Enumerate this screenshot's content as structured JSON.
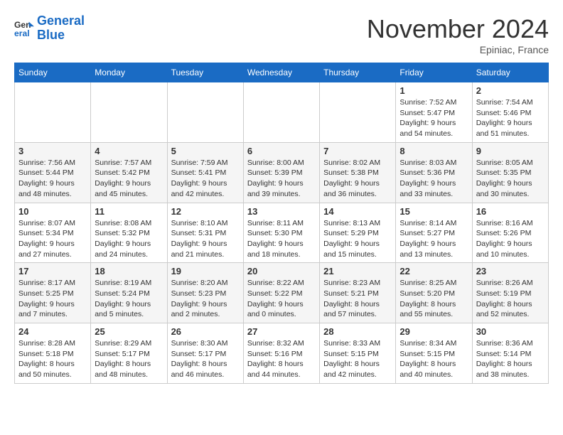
{
  "header": {
    "logo_line1": "General",
    "logo_line2": "Blue",
    "month": "November 2024",
    "location": "Epiniac, France"
  },
  "weekdays": [
    "Sunday",
    "Monday",
    "Tuesday",
    "Wednesday",
    "Thursday",
    "Friday",
    "Saturday"
  ],
  "weeks": [
    [
      {
        "day": "",
        "info": ""
      },
      {
        "day": "",
        "info": ""
      },
      {
        "day": "",
        "info": ""
      },
      {
        "day": "",
        "info": ""
      },
      {
        "day": "",
        "info": ""
      },
      {
        "day": "1",
        "info": "Sunrise: 7:52 AM\nSunset: 5:47 PM\nDaylight: 9 hours and 54 minutes."
      },
      {
        "day": "2",
        "info": "Sunrise: 7:54 AM\nSunset: 5:46 PM\nDaylight: 9 hours and 51 minutes."
      }
    ],
    [
      {
        "day": "3",
        "info": "Sunrise: 7:56 AM\nSunset: 5:44 PM\nDaylight: 9 hours and 48 minutes."
      },
      {
        "day": "4",
        "info": "Sunrise: 7:57 AM\nSunset: 5:42 PM\nDaylight: 9 hours and 45 minutes."
      },
      {
        "day": "5",
        "info": "Sunrise: 7:59 AM\nSunset: 5:41 PM\nDaylight: 9 hours and 42 minutes."
      },
      {
        "day": "6",
        "info": "Sunrise: 8:00 AM\nSunset: 5:39 PM\nDaylight: 9 hours and 39 minutes."
      },
      {
        "day": "7",
        "info": "Sunrise: 8:02 AM\nSunset: 5:38 PM\nDaylight: 9 hours and 36 minutes."
      },
      {
        "day": "8",
        "info": "Sunrise: 8:03 AM\nSunset: 5:36 PM\nDaylight: 9 hours and 33 minutes."
      },
      {
        "day": "9",
        "info": "Sunrise: 8:05 AM\nSunset: 5:35 PM\nDaylight: 9 hours and 30 minutes."
      }
    ],
    [
      {
        "day": "10",
        "info": "Sunrise: 8:07 AM\nSunset: 5:34 PM\nDaylight: 9 hours and 27 minutes."
      },
      {
        "day": "11",
        "info": "Sunrise: 8:08 AM\nSunset: 5:32 PM\nDaylight: 9 hours and 24 minutes."
      },
      {
        "day": "12",
        "info": "Sunrise: 8:10 AM\nSunset: 5:31 PM\nDaylight: 9 hours and 21 minutes."
      },
      {
        "day": "13",
        "info": "Sunrise: 8:11 AM\nSunset: 5:30 PM\nDaylight: 9 hours and 18 minutes."
      },
      {
        "day": "14",
        "info": "Sunrise: 8:13 AM\nSunset: 5:29 PM\nDaylight: 9 hours and 15 minutes."
      },
      {
        "day": "15",
        "info": "Sunrise: 8:14 AM\nSunset: 5:27 PM\nDaylight: 9 hours and 13 minutes."
      },
      {
        "day": "16",
        "info": "Sunrise: 8:16 AM\nSunset: 5:26 PM\nDaylight: 9 hours and 10 minutes."
      }
    ],
    [
      {
        "day": "17",
        "info": "Sunrise: 8:17 AM\nSunset: 5:25 PM\nDaylight: 9 hours and 7 minutes."
      },
      {
        "day": "18",
        "info": "Sunrise: 8:19 AM\nSunset: 5:24 PM\nDaylight: 9 hours and 5 minutes."
      },
      {
        "day": "19",
        "info": "Sunrise: 8:20 AM\nSunset: 5:23 PM\nDaylight: 9 hours and 2 minutes."
      },
      {
        "day": "20",
        "info": "Sunrise: 8:22 AM\nSunset: 5:22 PM\nDaylight: 9 hours and 0 minutes."
      },
      {
        "day": "21",
        "info": "Sunrise: 8:23 AM\nSunset: 5:21 PM\nDaylight: 8 hours and 57 minutes."
      },
      {
        "day": "22",
        "info": "Sunrise: 8:25 AM\nSunset: 5:20 PM\nDaylight: 8 hours and 55 minutes."
      },
      {
        "day": "23",
        "info": "Sunrise: 8:26 AM\nSunset: 5:19 PM\nDaylight: 8 hours and 52 minutes."
      }
    ],
    [
      {
        "day": "24",
        "info": "Sunrise: 8:28 AM\nSunset: 5:18 PM\nDaylight: 8 hours and 50 minutes."
      },
      {
        "day": "25",
        "info": "Sunrise: 8:29 AM\nSunset: 5:17 PM\nDaylight: 8 hours and 48 minutes."
      },
      {
        "day": "26",
        "info": "Sunrise: 8:30 AM\nSunset: 5:17 PM\nDaylight: 8 hours and 46 minutes."
      },
      {
        "day": "27",
        "info": "Sunrise: 8:32 AM\nSunset: 5:16 PM\nDaylight: 8 hours and 44 minutes."
      },
      {
        "day": "28",
        "info": "Sunrise: 8:33 AM\nSunset: 5:15 PM\nDaylight: 8 hours and 42 minutes."
      },
      {
        "day": "29",
        "info": "Sunrise: 8:34 AM\nSunset: 5:15 PM\nDaylight: 8 hours and 40 minutes."
      },
      {
        "day": "30",
        "info": "Sunrise: 8:36 AM\nSunset: 5:14 PM\nDaylight: 8 hours and 38 minutes."
      }
    ]
  ]
}
